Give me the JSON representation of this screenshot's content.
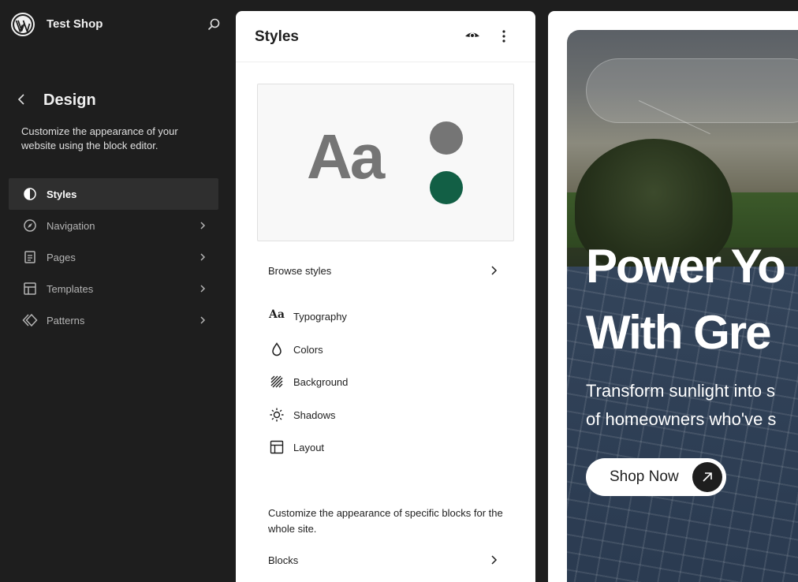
{
  "topbar": {
    "site_name": "Test Shop"
  },
  "design": {
    "title": "Design",
    "description": "Customize the appearance of your website using the block editor."
  },
  "nav": {
    "items": [
      {
        "label": "Styles",
        "icon": "half-circle-icon",
        "active": true
      },
      {
        "label": "Navigation",
        "icon": "compass-icon",
        "active": false
      },
      {
        "label": "Pages",
        "icon": "page-icon",
        "active": false
      },
      {
        "label": "Templates",
        "icon": "layout-icon",
        "active": false
      },
      {
        "label": "Patterns",
        "icon": "symbol-icon",
        "active": false
      }
    ]
  },
  "panel": {
    "title": "Styles",
    "preview_text": "Aa",
    "browse_label": "Browse styles",
    "items": [
      {
        "label": "Typography",
        "icon": "typography-icon",
        "glyph": "Aa"
      },
      {
        "label": "Colors",
        "icon": "droplet-icon"
      },
      {
        "label": "Background",
        "icon": "background-icon"
      },
      {
        "label": "Shadows",
        "icon": "sun-icon"
      },
      {
        "label": "Layout",
        "icon": "layout-icon"
      }
    ],
    "blocks_description": "Customize the appearance of specific blocks for the whole site.",
    "blocks_label": "Blocks"
  },
  "colors": {
    "sidebar_bg": "#1e1e1e",
    "preview_grey": "#757575",
    "preview_green": "#125f45"
  },
  "hero": {
    "title_line1": "Power Yo",
    "title_line2": "With Gre",
    "subtitle_line1": "Transform sunlight into s",
    "subtitle_line2": "of homeowners who've s",
    "button_label": "Shop Now"
  }
}
